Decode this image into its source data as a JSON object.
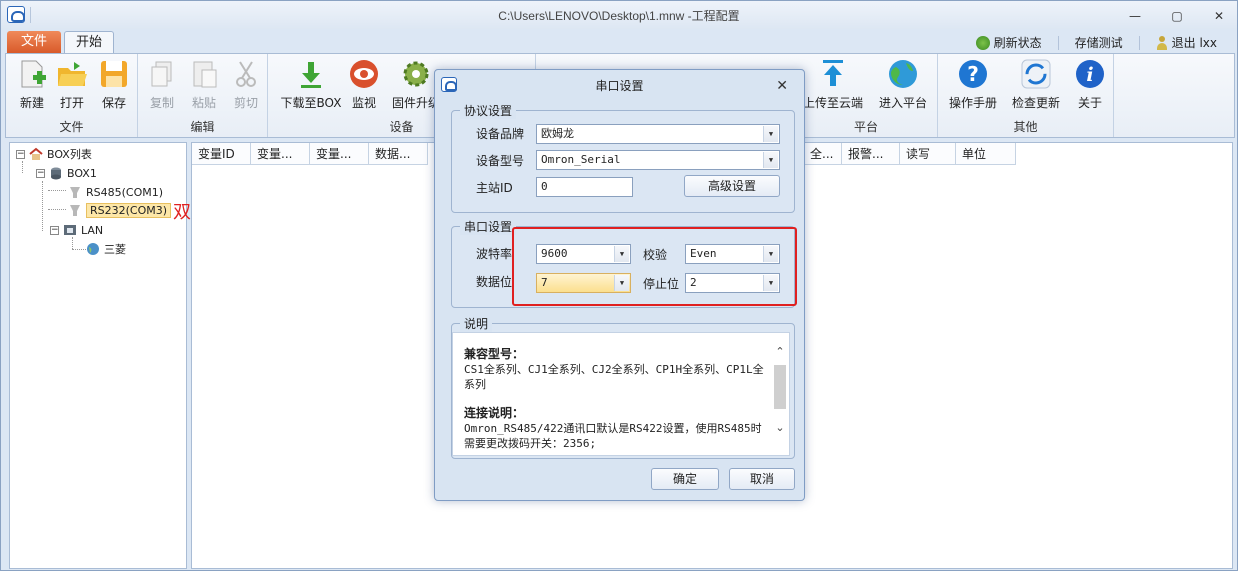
{
  "window": {
    "title": "C:\\Users\\LENOVO\\Desktop\\1.mnw -工程配置"
  },
  "tabs": {
    "file": "文件",
    "start": "开始"
  },
  "topright": {
    "refresh": "刷新状态",
    "storage_test": "存储测试",
    "logout": "退出 lxx"
  },
  "ribbon": {
    "groups": {
      "file": "文件",
      "edit": "编辑",
      "device": "设备",
      "platform": "平台",
      "other": "其他"
    },
    "buttons": {
      "new": "新建",
      "open": "打开",
      "save": "保存",
      "copy": "复制",
      "paste": "粘贴",
      "cut": "剪切",
      "download": "下载至BOX",
      "monitor": "监视",
      "firmware": "固件升级",
      "upload": "上传至云端",
      "enter_platform": "进入平台",
      "manual": "操作手册",
      "check_update": "检查更新",
      "about": "关于"
    }
  },
  "tree": {
    "root": "BOX列表",
    "box": "BOX1",
    "rs485": "RS485(COM1)",
    "rs232": "RS232(COM3)",
    "lan": "LAN",
    "mitsubishi": "三菱"
  },
  "annotation": {
    "double_click": "双击"
  },
  "grid": {
    "columns_left": [
      "变量ID",
      "变量...",
      "变量...",
      "数据..."
    ],
    "columns_right": [
      "全...",
      "报警...",
      "读写",
      "单位"
    ]
  },
  "dialog": {
    "title": "串口设置",
    "protocol": {
      "legend": "协议设置",
      "brand_label": "设备品牌",
      "brand_value": "欧姆龙",
      "model_label": "设备型号",
      "model_value": "Omron_Serial",
      "station_label": "主站ID",
      "station_value": "0",
      "advanced_button": "高级设置"
    },
    "serial": {
      "legend": "串口设置",
      "baud_label": "波特率",
      "baud_value": "9600",
      "parity_label": "校验",
      "parity_value": "Even",
      "databits_label": "数据位",
      "databits_value": "7",
      "stopbits_label": "停止位",
      "stopbits_value": "2"
    },
    "description": {
      "legend": "说明",
      "compat_heading": "兼容型号：",
      "compat_text": "CS1全系列、CJ1全系列、CJ2全系列、CP1H全系列、CP1L全系列",
      "conn_heading": "连接说明：",
      "conn_text": "Omron_RS485/422通讯口默认是RS422设置，使用RS485时需要更改拨码开关：2356;"
    },
    "ok": "确定",
    "cancel": "取消"
  },
  "colors": {
    "accent": "#2b66b8",
    "file_tab": "#e06a36",
    "highlight_box": "#e02020"
  }
}
